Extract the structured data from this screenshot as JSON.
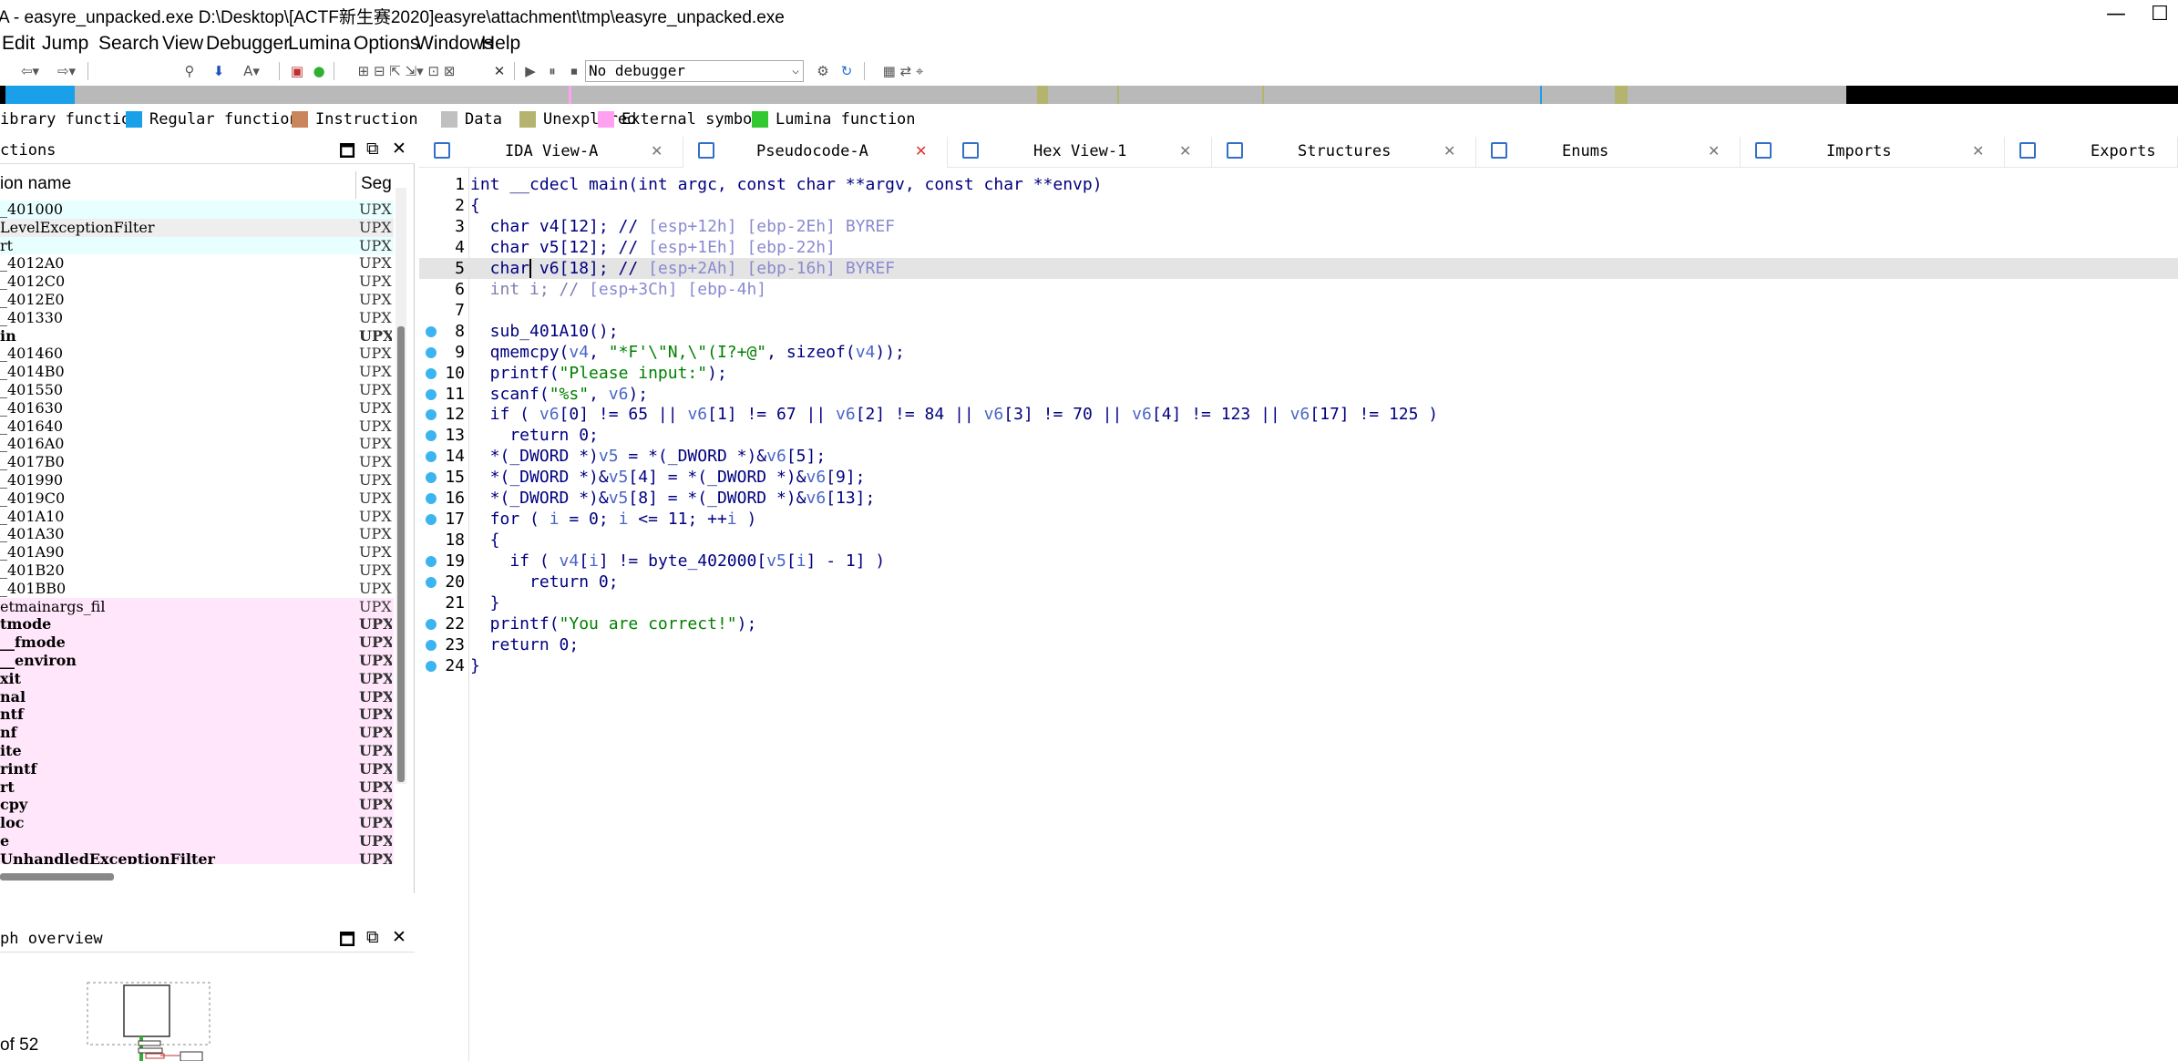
{
  "window": {
    "title": "A - easyre_unpacked.exe D:\\Desktop\\[ACTF新生赛2020]easyre\\attachment\\tmp\\easyre_unpacked.exe",
    "minimize": "—",
    "maximize": "☐"
  },
  "menu": [
    "Edit",
    "Jump",
    "Search",
    "View",
    "Debugger",
    "Lumina",
    "Options",
    "Windows",
    "Help"
  ],
  "toolbar": {
    "debugger_value": "No debugger"
  },
  "legend": [
    {
      "label": "ibrary function",
      "color": ""
    },
    {
      "label": "Regular function",
      "color": "#1aa0e8"
    },
    {
      "label": "Instruction",
      "color": "#c8865a"
    },
    {
      "label": "Data",
      "color": "#c0c0c0"
    },
    {
      "label": "Unexplored",
      "color": "#b4b46e"
    },
    {
      "label": "External symbol",
      "color": "#ffa0f0"
    },
    {
      "label": "Lumina function",
      "color": "#32c832"
    }
  ],
  "functions": {
    "title": "ctions",
    "col_name": "ion name",
    "col_seg": "Seg",
    "rows": [
      {
        "name": "_401000",
        "seg": "UPX(",
        "bold": false,
        "bg": "#e8ffff"
      },
      {
        "name": "LevelExceptionFilter",
        "seg": "UPX(",
        "bold": false,
        "bg": "#eeeeee"
      },
      {
        "name": "rt",
        "seg": "UPX(",
        "bold": false,
        "bg": "#e8ffff"
      },
      {
        "name": "_4012A0",
        "seg": "UPX(",
        "bold": false,
        "bg": "#ffffff"
      },
      {
        "name": "_4012C0",
        "seg": "UPX(",
        "bold": false,
        "bg": "#ffffff"
      },
      {
        "name": "_4012E0",
        "seg": "UPX(",
        "bold": false,
        "bg": "#ffffff"
      },
      {
        "name": "_401330",
        "seg": "UPX(",
        "bold": false,
        "bg": "#ffffff"
      },
      {
        "name": "in",
        "seg": "UPX(",
        "bold": true,
        "bg": "#ffffff"
      },
      {
        "name": "_401460",
        "seg": "UPX(",
        "bold": false,
        "bg": "#ffffff"
      },
      {
        "name": "_4014B0",
        "seg": "UPX(",
        "bold": false,
        "bg": "#ffffff"
      },
      {
        "name": "_401550",
        "seg": "UPX(",
        "bold": false,
        "bg": "#ffffff"
      },
      {
        "name": "_401630",
        "seg": "UPX(",
        "bold": false,
        "bg": "#ffffff"
      },
      {
        "name": "_401640",
        "seg": "UPX(",
        "bold": false,
        "bg": "#ffffff"
      },
      {
        "name": "_4016A0",
        "seg": "UPX(",
        "bold": false,
        "bg": "#ffffff"
      },
      {
        "name": "_4017B0",
        "seg": "UPX(",
        "bold": false,
        "bg": "#ffffff"
      },
      {
        "name": "_401990",
        "seg": "UPX(",
        "bold": false,
        "bg": "#ffffff"
      },
      {
        "name": "_4019C0",
        "seg": "UPX(",
        "bold": false,
        "bg": "#ffffff"
      },
      {
        "name": "_401A10",
        "seg": "UPX(",
        "bold": false,
        "bg": "#ffffff"
      },
      {
        "name": "_401A30",
        "seg": "UPX(",
        "bold": false,
        "bg": "#ffffff"
      },
      {
        "name": "_401A90",
        "seg": "UPX(",
        "bold": false,
        "bg": "#ffffff"
      },
      {
        "name": "_401B20",
        "seg": "UPX(",
        "bold": false,
        "bg": "#ffffff"
      },
      {
        "name": "_401BB0",
        "seg": "UPX(",
        "bold": false,
        "bg": "#ffffff"
      },
      {
        "name": "etmainargs_fil",
        "seg": "UPX(",
        "bold": false,
        "bg": "#ffe6fa"
      },
      {
        "name": "tmode",
        "seg": "UPX(",
        "bold": true,
        "bg": "#ffe6fa"
      },
      {
        "name": "__fmode",
        "seg": "UPX(",
        "bold": true,
        "bg": "#ffe6fa"
      },
      {
        "name": "__environ",
        "seg": "UPX(",
        "bold": true,
        "bg": "#ffe6fa"
      },
      {
        "name": "xit",
        "seg": "UPX(",
        "bold": true,
        "bg": "#ffe6fa"
      },
      {
        "name": "nal",
        "seg": "UPX(",
        "bold": true,
        "bg": "#ffe6fa"
      },
      {
        "name": "ntf",
        "seg": "UPX(",
        "bold": true,
        "bg": "#ffe6fa"
      },
      {
        "name": "nf",
        "seg": "UPX(",
        "bold": true,
        "bg": "#ffe6fa"
      },
      {
        "name": "ite",
        "seg": "UPX(",
        "bold": true,
        "bg": "#ffe6fa"
      },
      {
        "name": "rintf",
        "seg": "UPX(",
        "bold": true,
        "bg": "#ffe6fa"
      },
      {
        "name": "rt",
        "seg": "UPX(",
        "bold": true,
        "bg": "#ffe6fa"
      },
      {
        "name": "cpy",
        "seg": "UPX(",
        "bold": true,
        "bg": "#ffe6fa"
      },
      {
        "name": "loc",
        "seg": "UPX(",
        "bold": true,
        "bg": "#ffe6fa"
      },
      {
        "name": "e",
        "seg": "UPX(",
        "bold": true,
        "bg": "#ffe6fa"
      },
      {
        "name": "UnhandledExceptionFilter",
        "seg": "UPX(",
        "bold": true,
        "bg": "#ffe6fa"
      }
    ],
    "count": "of 52"
  },
  "graph": {
    "title": "ph overview"
  },
  "tabs": [
    {
      "label": "IDA View-A",
      "active": false
    },
    {
      "label": "Pseudocode-A",
      "active": true
    },
    {
      "label": "Hex View-1",
      "active": false
    },
    {
      "label": "Structures",
      "active": false
    },
    {
      "label": "Enums",
      "active": false
    },
    {
      "label": "Imports",
      "active": false
    },
    {
      "label": "Exports",
      "active": false
    }
  ],
  "code": [
    {
      "n": "1",
      "bp": false,
      "t": [
        [
          "k",
          "int __cdecl main(int argc, const char **argv, const char **envp)"
        ]
      ]
    },
    {
      "n": "2",
      "bp": false,
      "t": [
        [
          "k",
          "{"
        ]
      ]
    },
    {
      "n": "3",
      "bp": false,
      "t": [
        [
          "k",
          "  char v4[12]; // "
        ],
        [
          "c",
          "[esp+12h] [ebp-2Eh] BYREF"
        ]
      ]
    },
    {
      "n": "4",
      "bp": false,
      "t": [
        [
          "k",
          "  char v5[12]; // "
        ],
        [
          "c",
          "[esp+1Eh] [ebp-22h]"
        ]
      ]
    },
    {
      "n": "5",
      "bp": false,
      "hl": true,
      "t": [
        [
          "k",
          "  char v6[18]; // "
        ],
        [
          "c",
          "[esp+2Ah] [ebp-16h] BYREF"
        ]
      ]
    },
    {
      "n": "6",
      "bp": false,
      "t": [
        [
          "g",
          "  int i; // "
        ],
        [
          "c",
          "[esp+3Ch] [ebp-4h]"
        ]
      ]
    },
    {
      "n": "7",
      "bp": false,
      "t": [
        [
          "k",
          ""
        ]
      ]
    },
    {
      "n": "8",
      "bp": true,
      "t": [
        [
          "k",
          "  sub_401A10();"
        ]
      ]
    },
    {
      "n": "9",
      "bp": true,
      "t": [
        [
          "k",
          "  qmemcpy("
        ],
        [
          "v",
          "v4"
        ],
        [
          "k",
          ", "
        ],
        [
          "s",
          "\"*F'\\\"N,\\\"(I?+@\""
        ],
        [
          "k",
          ", sizeof("
        ],
        [
          "v",
          "v4"
        ],
        [
          "k",
          "));"
        ]
      ]
    },
    {
      "n": "10",
      "bp": true,
      "t": [
        [
          "k",
          "  printf("
        ],
        [
          "s",
          "\"Please input:\""
        ],
        [
          "k",
          ");"
        ]
      ]
    },
    {
      "n": "11",
      "bp": true,
      "t": [
        [
          "k",
          "  scanf("
        ],
        [
          "s",
          "\"%s\""
        ],
        [
          "k",
          ", "
        ],
        [
          "v",
          "v6"
        ],
        [
          "k",
          ");"
        ]
      ]
    },
    {
      "n": "12",
      "bp": true,
      "t": [
        [
          "k",
          "  if ( "
        ],
        [
          "v",
          "v6"
        ],
        [
          "k",
          "[0] != 65 || "
        ],
        [
          "v",
          "v6"
        ],
        [
          "k",
          "[1] != 67 || "
        ],
        [
          "v",
          "v6"
        ],
        [
          "k",
          "[2] != 84 || "
        ],
        [
          "v",
          "v6"
        ],
        [
          "k",
          "[3] != 70 || "
        ],
        [
          "v",
          "v6"
        ],
        [
          "k",
          "[4] != 123 || "
        ],
        [
          "v",
          "v6"
        ],
        [
          "k",
          "[17] != 125 )"
        ]
      ]
    },
    {
      "n": "13",
      "bp": true,
      "t": [
        [
          "k",
          "    return 0;"
        ]
      ]
    },
    {
      "n": "14",
      "bp": true,
      "t": [
        [
          "k",
          "  *(_DWORD *)"
        ],
        [
          "v",
          "v5"
        ],
        [
          "k",
          " = *(_DWORD *)&"
        ],
        [
          "v",
          "v6"
        ],
        [
          "k",
          "[5];"
        ]
      ]
    },
    {
      "n": "15",
      "bp": true,
      "t": [
        [
          "k",
          "  *(_DWORD *)&"
        ],
        [
          "v",
          "v5"
        ],
        [
          "k",
          "[4] = *(_DWORD *)&"
        ],
        [
          "v",
          "v6"
        ],
        [
          "k",
          "[9];"
        ]
      ]
    },
    {
      "n": "16",
      "bp": true,
      "t": [
        [
          "k",
          "  *(_DWORD *)&"
        ],
        [
          "v",
          "v5"
        ],
        [
          "k",
          "[8] = *(_DWORD *)&"
        ],
        [
          "v",
          "v6"
        ],
        [
          "k",
          "[13];"
        ]
      ]
    },
    {
      "n": "17",
      "bp": true,
      "t": [
        [
          "k",
          "  for ( "
        ],
        [
          "v",
          "i"
        ],
        [
          "k",
          " = 0; "
        ],
        [
          "v",
          "i"
        ],
        [
          "k",
          " <= 11; ++"
        ],
        [
          "v",
          "i"
        ],
        [
          "k",
          " )"
        ]
      ]
    },
    {
      "n": "18",
      "bp": false,
      "t": [
        [
          "k",
          "  {"
        ]
      ]
    },
    {
      "n": "19",
      "bp": true,
      "t": [
        [
          "k",
          "    if ( "
        ],
        [
          "v",
          "v4"
        ],
        [
          "k",
          "["
        ],
        [
          "v",
          "i"
        ],
        [
          "k",
          "] != byte_402000["
        ],
        [
          "v",
          "v5"
        ],
        [
          "k",
          "["
        ],
        [
          "v",
          "i"
        ],
        [
          "k",
          "] - 1] )"
        ]
      ]
    },
    {
      "n": "20",
      "bp": true,
      "t": [
        [
          "k",
          "      return 0;"
        ]
      ]
    },
    {
      "n": "21",
      "bp": false,
      "t": [
        [
          "k",
          "  }"
        ]
      ]
    },
    {
      "n": "22",
      "bp": true,
      "t": [
        [
          "k",
          "  printf("
        ],
        [
          "s",
          "\"You are correct!\""
        ],
        [
          "k",
          ");"
        ]
      ]
    },
    {
      "n": "23",
      "bp": true,
      "t": [
        [
          "k",
          "  return 0;"
        ]
      ]
    },
    {
      "n": "24",
      "bp": true,
      "t": [
        [
          "k",
          "}"
        ]
      ]
    }
  ]
}
